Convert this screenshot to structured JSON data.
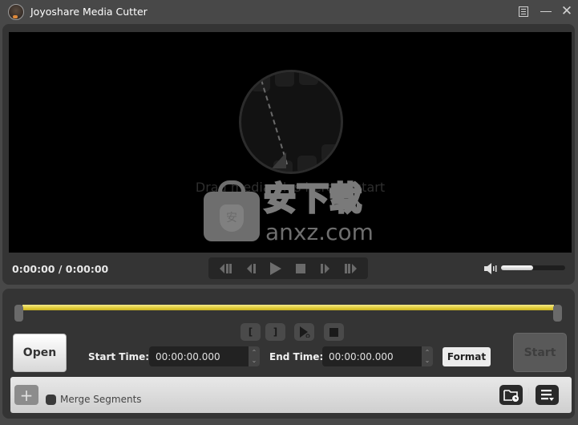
{
  "window": {
    "title": "Joyoshare Media Cutter",
    "controls": [
      "menu-icon",
      "minimize-icon",
      "close-icon"
    ],
    "close_glyph": "✕"
  },
  "player": {
    "drop_hint": "Drag media files here to start",
    "time_readout": "0:00:00 / 0:00:00",
    "transport": [
      {
        "name": "previous-segment",
        "icon": "skip-back-bars-icon"
      },
      {
        "name": "previous-frame",
        "icon": "step-back-icon"
      },
      {
        "name": "play",
        "icon": "play-icon"
      },
      {
        "name": "stop",
        "icon": "stop-icon"
      },
      {
        "name": "next-frame",
        "icon": "step-forward-icon"
      },
      {
        "name": "next-segment",
        "icon": "skip-forward-bars-icon"
      }
    ],
    "volume_percent": 50
  },
  "watermark": {
    "cn": "安下载",
    "en": "anxz.com",
    "shield_glyph": "安"
  },
  "editor": {
    "segment_buttons": [
      {
        "name": "set-start-bracket",
        "glyph": "["
      },
      {
        "name": "set-end-bracket",
        "glyph": "]"
      },
      {
        "name": "preview-segment",
        "glyph": "▶"
      },
      {
        "name": "stop-preview",
        "glyph": "■"
      }
    ],
    "open_label": "Open",
    "start_time_label": "Start Time:",
    "start_time_value": "00:00:00.000",
    "end_time_label": "End Time:",
    "end_time_value": "00:00:00.000",
    "spin_up": "⌃",
    "spin_down": "⌄",
    "format_label": "Format",
    "start_label": "Start"
  },
  "bottom": {
    "add_glyph": "+",
    "merge_label": "Merge Segments",
    "merge_checked": false
  },
  "colors": {
    "range_bar": "#e2cc38",
    "background": "#484848",
    "panel": "#343434"
  }
}
